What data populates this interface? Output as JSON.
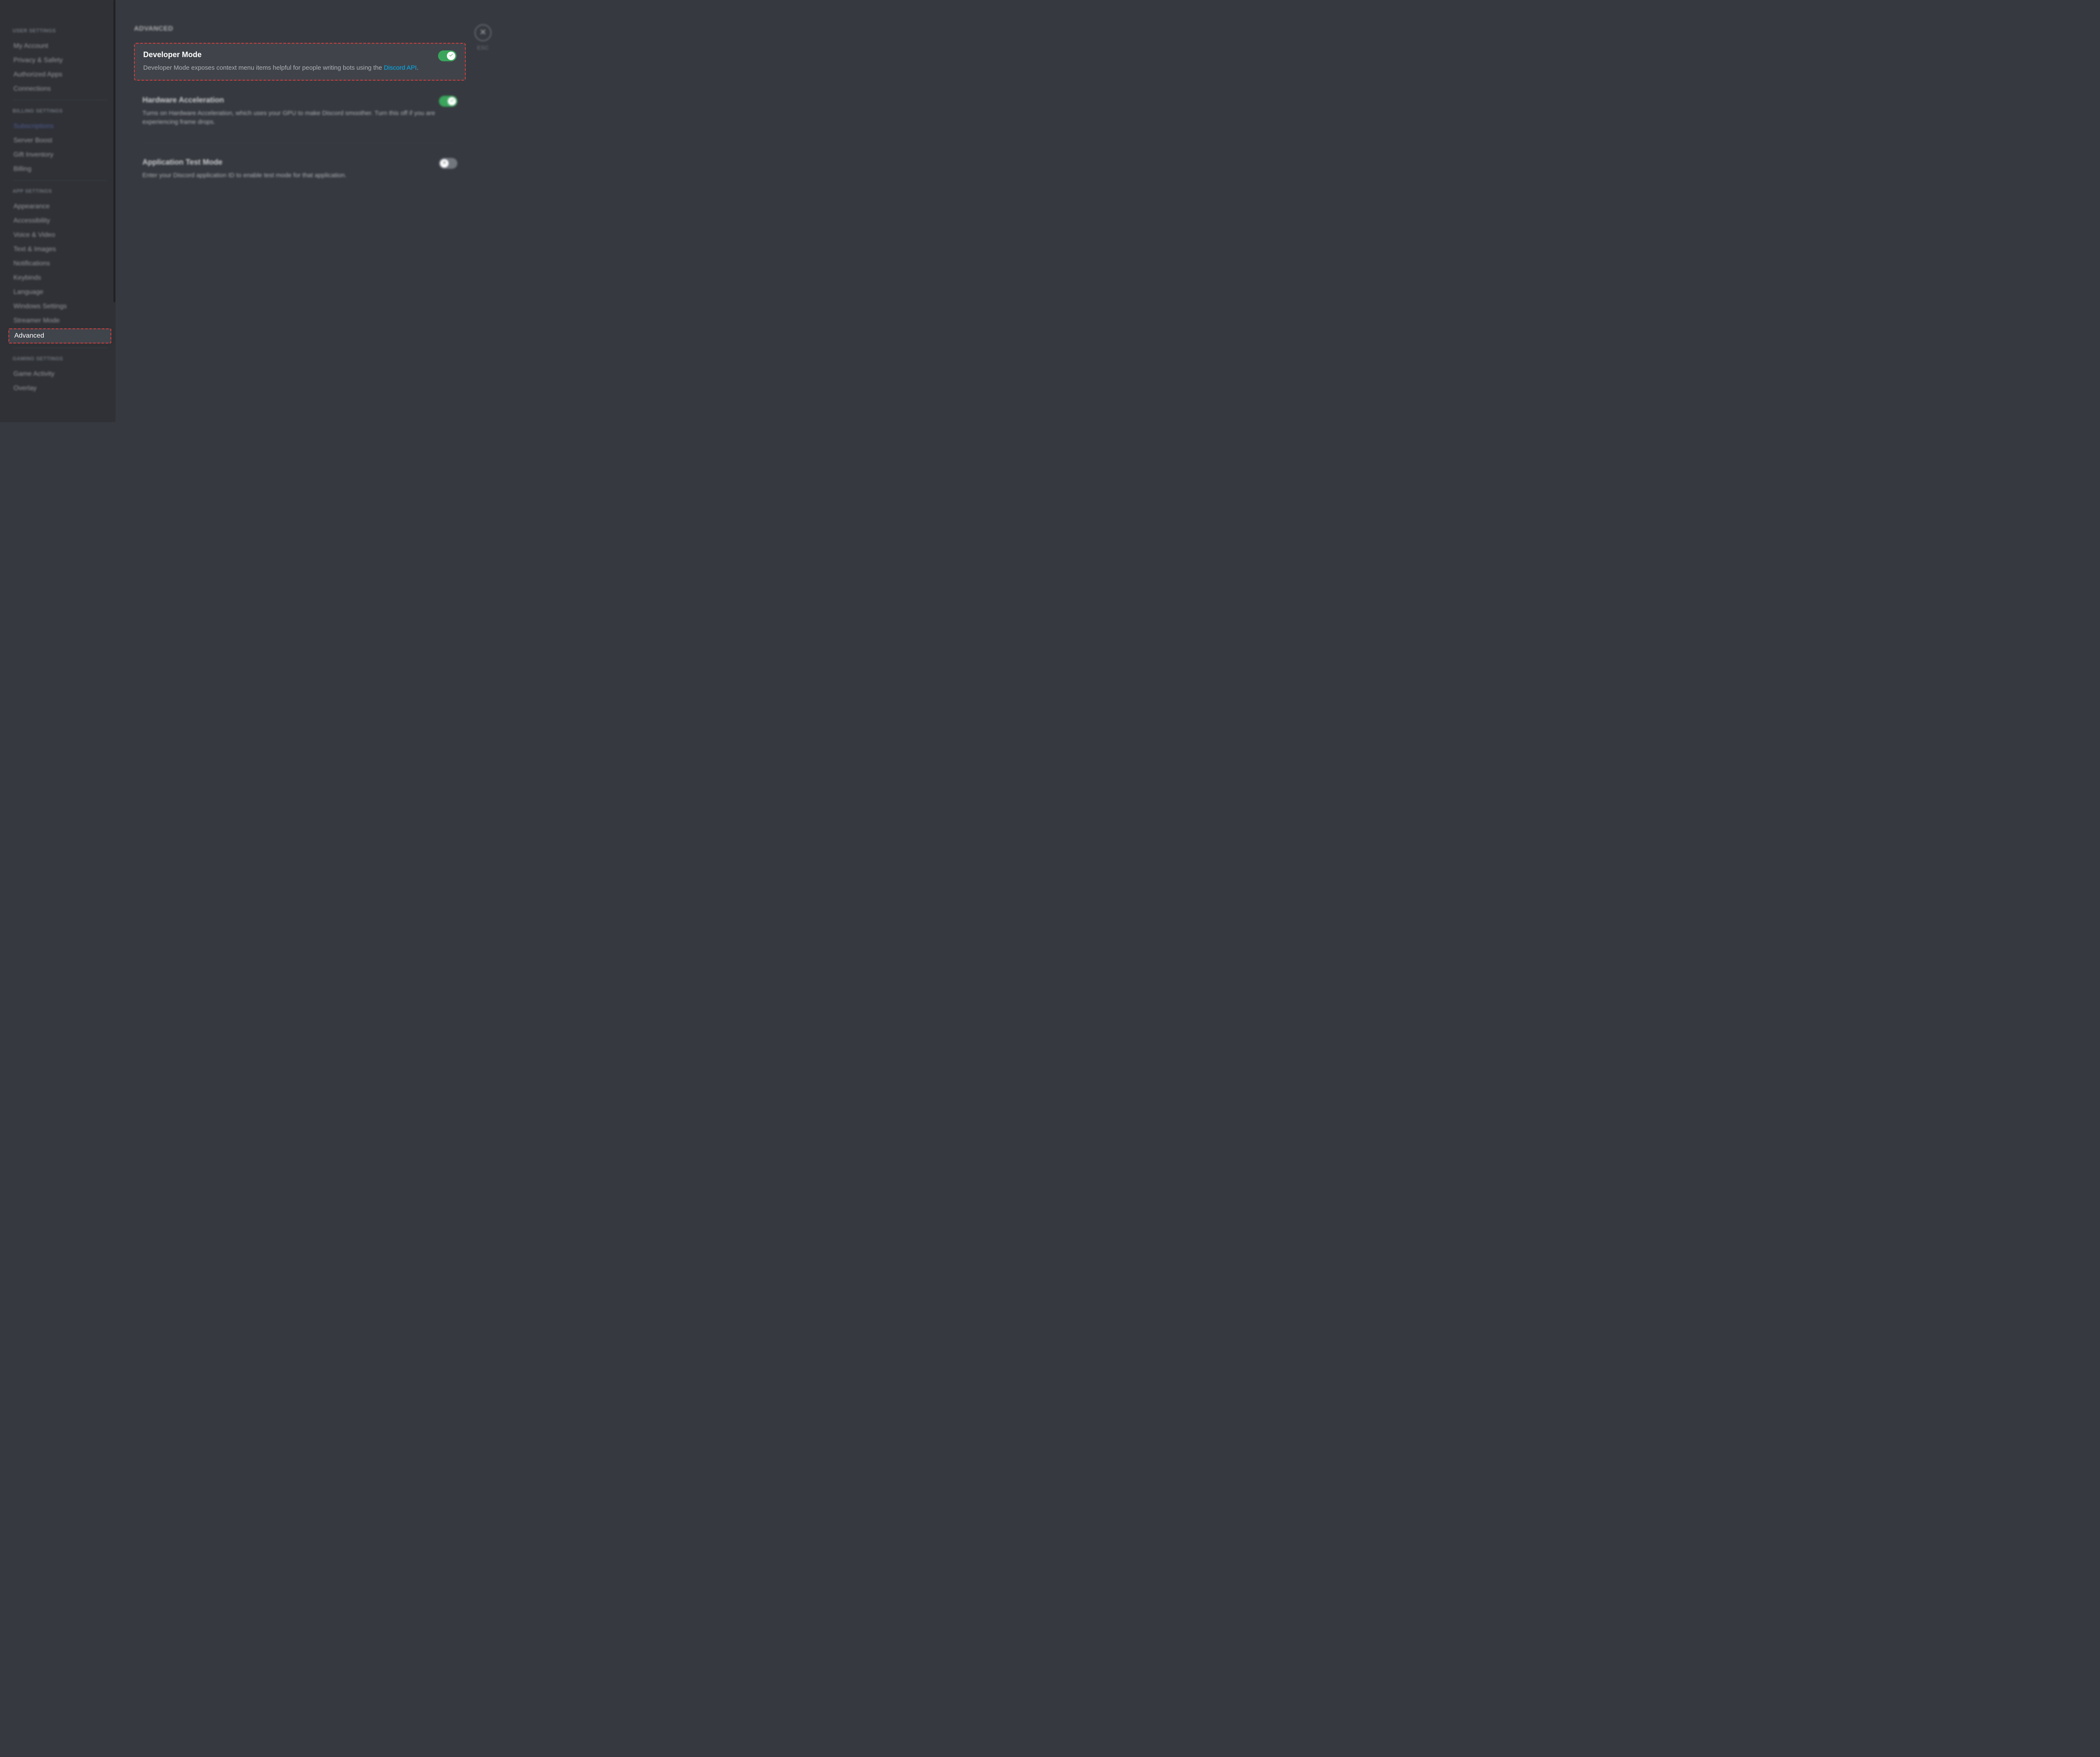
{
  "sidebar": {
    "sections": [
      {
        "header": "USER SETTINGS",
        "items": [
          {
            "label": "My Account",
            "name": "sidebar-item-my-account"
          },
          {
            "label": "Privacy & Safety",
            "name": "sidebar-item-privacy-safety"
          },
          {
            "label": "Authorized Apps",
            "name": "sidebar-item-authorized-apps"
          },
          {
            "label": "Connections",
            "name": "sidebar-item-connections"
          }
        ]
      },
      {
        "header": "BILLING SETTINGS",
        "items": [
          {
            "label": "Subscriptions",
            "name": "sidebar-item-subscriptions",
            "link": true
          },
          {
            "label": "Server Boost",
            "name": "sidebar-item-server-boost"
          },
          {
            "label": "Gift Inventory",
            "name": "sidebar-item-gift-inventory"
          },
          {
            "label": "Billing",
            "name": "sidebar-item-billing"
          }
        ]
      },
      {
        "header": "APP SETTINGS",
        "items": [
          {
            "label": "Appearance",
            "name": "sidebar-item-appearance"
          },
          {
            "label": "Accessibility",
            "name": "sidebar-item-accessibility"
          },
          {
            "label": "Voice & Video",
            "name": "sidebar-item-voice-video"
          },
          {
            "label": "Text & Images",
            "name": "sidebar-item-text-images"
          },
          {
            "label": "Notifications",
            "name": "sidebar-item-notifications"
          },
          {
            "label": "Keybinds",
            "name": "sidebar-item-keybinds"
          },
          {
            "label": "Language",
            "name": "sidebar-item-language"
          },
          {
            "label": "Windows Settings",
            "name": "sidebar-item-windows-settings"
          },
          {
            "label": "Streamer Mode",
            "name": "sidebar-item-streamer-mode"
          },
          {
            "label": "Advanced",
            "name": "sidebar-item-advanced",
            "active": true
          }
        ]
      },
      {
        "header": "GAMING SETTINGS",
        "items": [
          {
            "label": "Game Activity",
            "name": "sidebar-item-game-activity"
          },
          {
            "label": "Overlay",
            "name": "sidebar-item-overlay"
          }
        ]
      }
    ]
  },
  "main": {
    "title": "ADVANCED",
    "close_label": "ESC",
    "settings": [
      {
        "title": "Developer Mode",
        "desc_before": "Developer Mode exposes context menu items helpful for people writing bots using the ",
        "desc_link": "Discord API",
        "desc_after": ".",
        "enabled": true,
        "highlighted": true
      },
      {
        "title": "Hardware Acceleration",
        "desc": "Turns on Hardware Acceleration, which uses your GPU to make Discord smoother. Turn this off if you are experiencing frame drops.",
        "enabled": true,
        "highlighted": false
      },
      {
        "title": "Application Test Mode",
        "desc": "Enter your Discord application ID to enable test mode for that application.",
        "enabled": false,
        "highlighted": false
      }
    ]
  }
}
